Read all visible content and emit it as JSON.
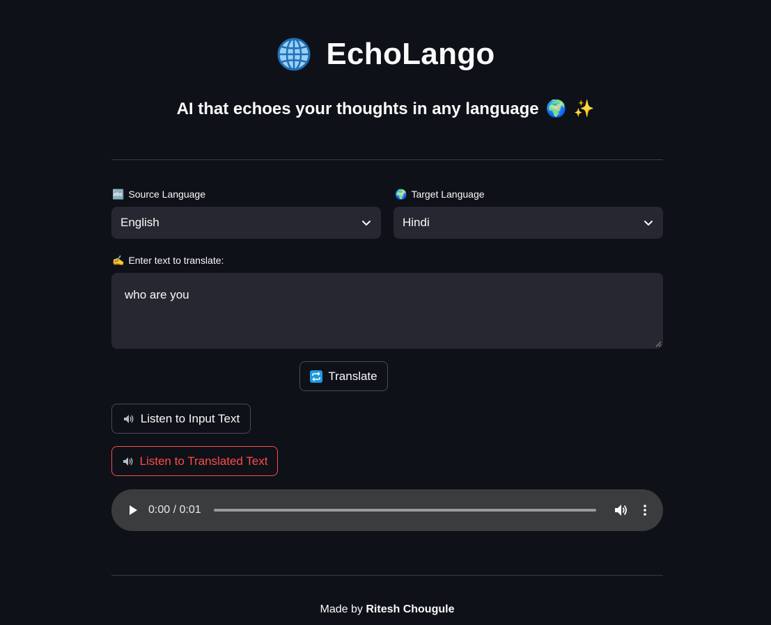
{
  "header": {
    "title": "EchoLango",
    "title_icon": "globe-with-meridians-icon",
    "subtitle": "AI that echoes your thoughts in any language",
    "subtitle_emojis": [
      "🌍",
      "✨"
    ]
  },
  "source_language": {
    "label": "Source Language",
    "label_emoji": "🔤",
    "selected": "English"
  },
  "target_language": {
    "label": "Target Language",
    "label_emoji": "🌍",
    "selected": "Hindi"
  },
  "input": {
    "label": "Enter text to translate:",
    "label_emoji": "✍️",
    "value": "who are you"
  },
  "buttons": {
    "translate_label": "Translate",
    "translate_icon": "repeat-icon",
    "listen_input_label": "Listen to Input Text",
    "listen_translated_label": "Listen to Translated Text",
    "speaker_icon": "speaker-icon"
  },
  "audio_player": {
    "time": "0:00 / 0:01",
    "progress": 0
  },
  "footer": {
    "prefix": "Made by",
    "author": "Ritesh Chougule"
  },
  "colors": {
    "background": "#0e1117",
    "input_bg": "#262730",
    "accent_red": "#ff4b4b",
    "audio_bg": "#3b3c3d"
  }
}
